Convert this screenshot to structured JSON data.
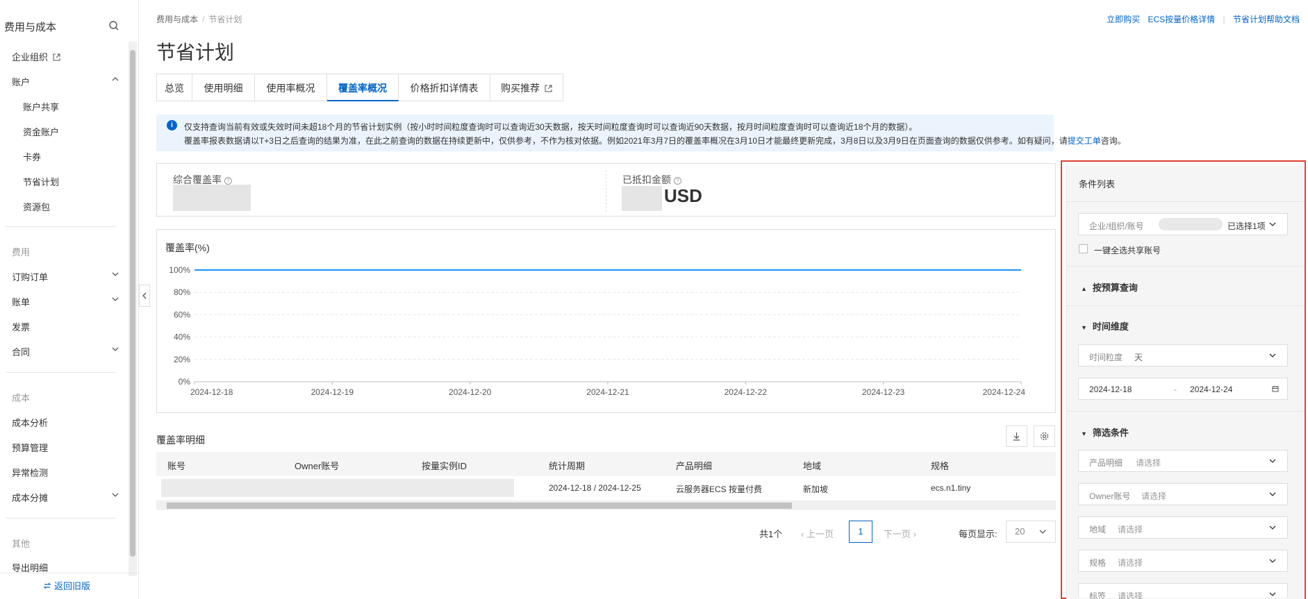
{
  "sidebar": {
    "title": "费用与成本",
    "items": {
      "org": "企业组织",
      "account": "账户",
      "account_share": "账户共享",
      "fund_account": "资金账户",
      "coupon": "卡券",
      "savings_plan": "节省计划",
      "resource_pack": "资源包",
      "group_fee": "费用",
      "orders": "订购订单",
      "bills": "账单",
      "invoice": "发票",
      "contract": "合同",
      "group_cost": "成本",
      "cost_analysis": "成本分析",
      "budget": "预算管理",
      "anomaly": "异常检测",
      "cost_allocation": "成本分摊",
      "group_other": "其他",
      "export": "导出明细"
    },
    "return_old": "返回旧版"
  },
  "breadcrumb": {
    "parent": "费用与成本",
    "sep": "/",
    "current": "节省计划"
  },
  "page_title": "节省计划",
  "top_links": {
    "buy": "立即购买",
    "ecs_price": "ECS按量价格详情",
    "help": "节省计划帮助文档"
  },
  "tabs": [
    "总览",
    "使用明细",
    "使用率概况",
    "覆盖率概况",
    "价格折扣详情表",
    "购买推荐"
  ],
  "notice": {
    "line1": "仅支持查询当前有效或失效时间未超18个月的节省计划实例（按小时时间粒度查询时可以查询近30天数据，按天时间粒度查询时可以查询近90天数据，按月时间粒度查询时可以查询近18个月的数据）。",
    "line2_a": "覆盖率报表数据请以T+3日之后查询的结果为准，在此之前查询的数据在持续更新中，仅供参考，不作为核对依据。例如2021年3月7日的覆盖率概况在3月10日才能最终更新完成，3月8日以及3月9日在页面查询的数据仅供参考。如有疑问，请",
    "line2_link": "提交工单",
    "line2_b": "咨询。"
  },
  "summary": {
    "coverage_label": "综合覆盖率",
    "deducted_label": "已抵扣金额",
    "currency": "USD"
  },
  "chart_data": {
    "type": "line",
    "title": "覆盖率(%)",
    "x": [
      "2024-12-18",
      "2024-12-19",
      "2024-12-20",
      "2024-12-21",
      "2024-12-22",
      "2024-12-23",
      "2024-12-24"
    ],
    "series": [
      {
        "values": [
          100,
          100,
          100,
          100,
          100,
          100,
          100
        ],
        "color": "#1890ff"
      }
    ],
    "yticks": [
      "0%",
      "20%",
      "40%",
      "60%",
      "80%",
      "100%"
    ],
    "ylim": [
      0,
      100
    ],
    "grid": true
  },
  "table": {
    "title": "覆盖率明细",
    "columns": [
      "账号",
      "Owner账号",
      "按量实例ID",
      "统计周期",
      "产品明细",
      "地域",
      "规格"
    ],
    "rows": [
      {
        "period": "2024-12-18 / 2024-12-25",
        "product": "云服务器ECS 按量付费",
        "region": "新加坡",
        "spec": "ecs.n1.tiny"
      }
    ]
  },
  "pagination": {
    "total": "共1个",
    "prev": "上一页",
    "current": "1",
    "next": "下一页",
    "page_size_label": "每页显示:",
    "page_size": "20"
  },
  "panel": {
    "title": "条件列表",
    "account_label": "企业/组织/账号",
    "account_value": "已选择1项",
    "select_all_shared": "一键全选共享账号",
    "budget_query": "按预算查询",
    "time_dimension": "时间维度",
    "granularity_label": "时间粒度",
    "granularity_value": "天",
    "date_start": "2024-12-18",
    "date_end": "2024-12-24",
    "filter": "筛选条件",
    "product_label": "产品明细",
    "owner_label": "Owner账号",
    "region_label": "地域",
    "spec_label": "规格",
    "tag_label": "标签",
    "placeholder": "请选择"
  }
}
